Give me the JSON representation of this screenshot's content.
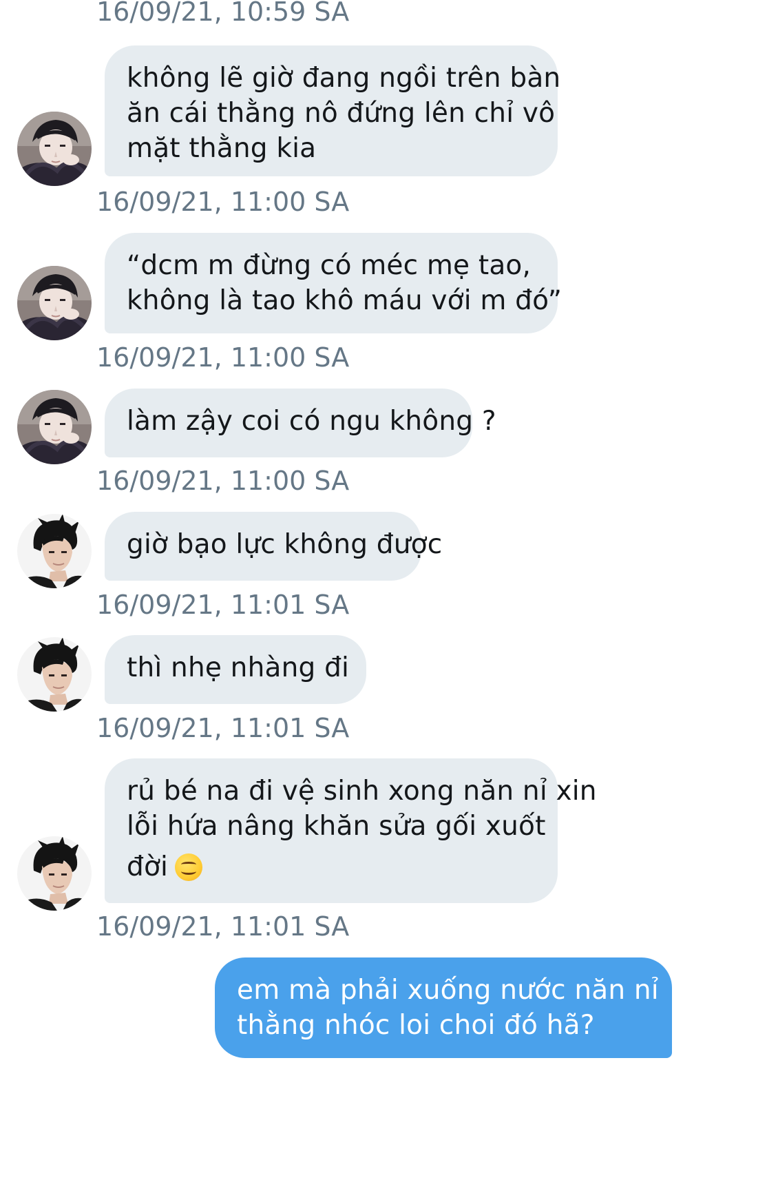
{
  "conversation": {
    "messages": [
      {
        "direction": "incoming",
        "avatar_icon": "user-a-avatar-icon",
        "lines": [
          "không lẽ giờ đang ngồi trên bàn",
          "ăn cái thằng nô đứng lên chỉ vô",
          "mặt thằng kia"
        ],
        "timestamp": "16/09/21, 11:00 SA"
      },
      {
        "direction": "incoming",
        "avatar_icon": "user-a-avatar-icon",
        "lines": [
          "“dcm m đừng có méc mẹ tao,",
          "không là tao khô máu với m đó”"
        ],
        "timestamp": "16/09/21, 11:00 SA"
      },
      {
        "direction": "incoming",
        "avatar_icon": "user-a-avatar-icon",
        "lines": [
          "làm zậy coi có ngu không ?"
        ],
        "timestamp": "16/09/21, 11:00 SA"
      },
      {
        "direction": "incoming",
        "avatar_icon": "user-b-avatar-icon",
        "lines": [
          "giờ bạo lực không được"
        ],
        "timestamp": "16/09/21, 11:01 SA"
      },
      {
        "direction": "incoming",
        "avatar_icon": "user-b-avatar-icon",
        "lines": [
          "thì nhẹ nhàng đi"
        ],
        "timestamp": "16/09/21, 11:01 SA"
      },
      {
        "direction": "incoming",
        "avatar_icon": "user-b-avatar-icon",
        "lines": [
          "rủ bé na đi vệ sinh xong năn nỉ xin",
          "lỗi hứa nâng khăn sửa gối xuốt",
          "đời"
        ],
        "emoji_icon": "smiling-face-emoji-icon",
        "timestamp": "16/09/21, 11:01 SA"
      },
      {
        "direction": "outgoing",
        "lines": [
          "em mà phải xuống nước năn nỉ",
          "thằng nhóc loi choi đó hã?"
        ]
      }
    ],
    "top_timestamp_partial": "16/09/21, 10:59 SA"
  },
  "colors": {
    "incoming_bubble": "#e6ecf0",
    "outgoing_bubble": "#4aa1eb",
    "timestamp_text": "#657786",
    "message_text": "#14171a"
  }
}
